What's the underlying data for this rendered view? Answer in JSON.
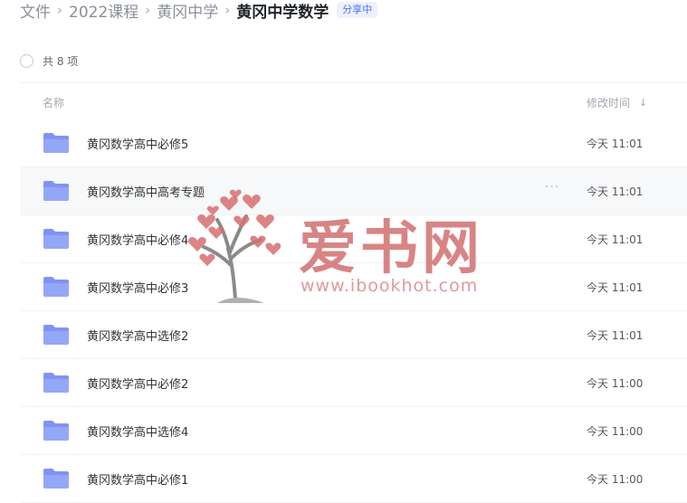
{
  "breadcrumb": {
    "items": [
      "文件",
      "2022课程",
      "黄冈中学"
    ],
    "current": "黄冈中学数学",
    "badge": "分享中"
  },
  "toolbar": {
    "count_label": "共 8 项"
  },
  "table": {
    "col_name": "名称",
    "col_time": "修改时间",
    "sort_icon": "↓",
    "more_icon": "···",
    "rows": [
      {
        "name": "黄冈数学高中必修5",
        "time": "今天 11:01"
      },
      {
        "name": "黄冈数学高中高考专题",
        "time": "今天 11:01"
      },
      {
        "name": "黄冈数学高中必修4",
        "time": "今天 11:01"
      },
      {
        "name": "黄冈数学高中必修3",
        "time": "今天 11:01"
      },
      {
        "name": "黄冈数学高中选修2",
        "time": "今天 11:01"
      },
      {
        "name": "黄冈数学高中必修2",
        "time": "今天 11:00"
      },
      {
        "name": "黄冈数学高中选修4",
        "time": "今天 11:00"
      },
      {
        "name": "黄冈数学高中必修1",
        "time": "今天 11:00"
      }
    ]
  },
  "watermark": {
    "title": "爱书网",
    "url": "www.ibookhot.com"
  },
  "colors": {
    "accent": "#4b6ef5",
    "folder": "#7f93f5",
    "watermark": "#cd6262"
  }
}
